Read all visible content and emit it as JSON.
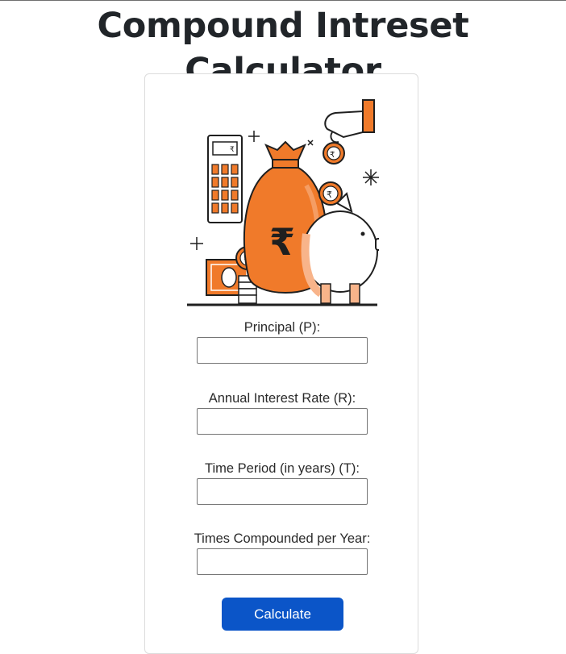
{
  "page": {
    "title": "Compound Intreset Calculator"
  },
  "form": {
    "fields": [
      {
        "label": "Principal (P):",
        "value": "",
        "placeholder": ""
      },
      {
        "label": "Annual Interest Rate (R):",
        "value": "",
        "placeholder": ""
      },
      {
        "label": "Time Period (in years) (T):",
        "value": "",
        "placeholder": ""
      },
      {
        "label": "Times Compounded per Year:",
        "value": "",
        "placeholder": ""
      }
    ],
    "submit_label": "Calculate"
  },
  "illustration": {
    "icons": [
      "calculator-icon",
      "money-bag-icon",
      "piggy-bank-icon",
      "rupee-coin-icon",
      "hand-icon",
      "banknote-icon"
    ],
    "currency_symbol": "₹"
  },
  "colors": {
    "accent_orange": "#f07a2a",
    "button_blue": "#0b55c8",
    "title_text": "#212529"
  }
}
